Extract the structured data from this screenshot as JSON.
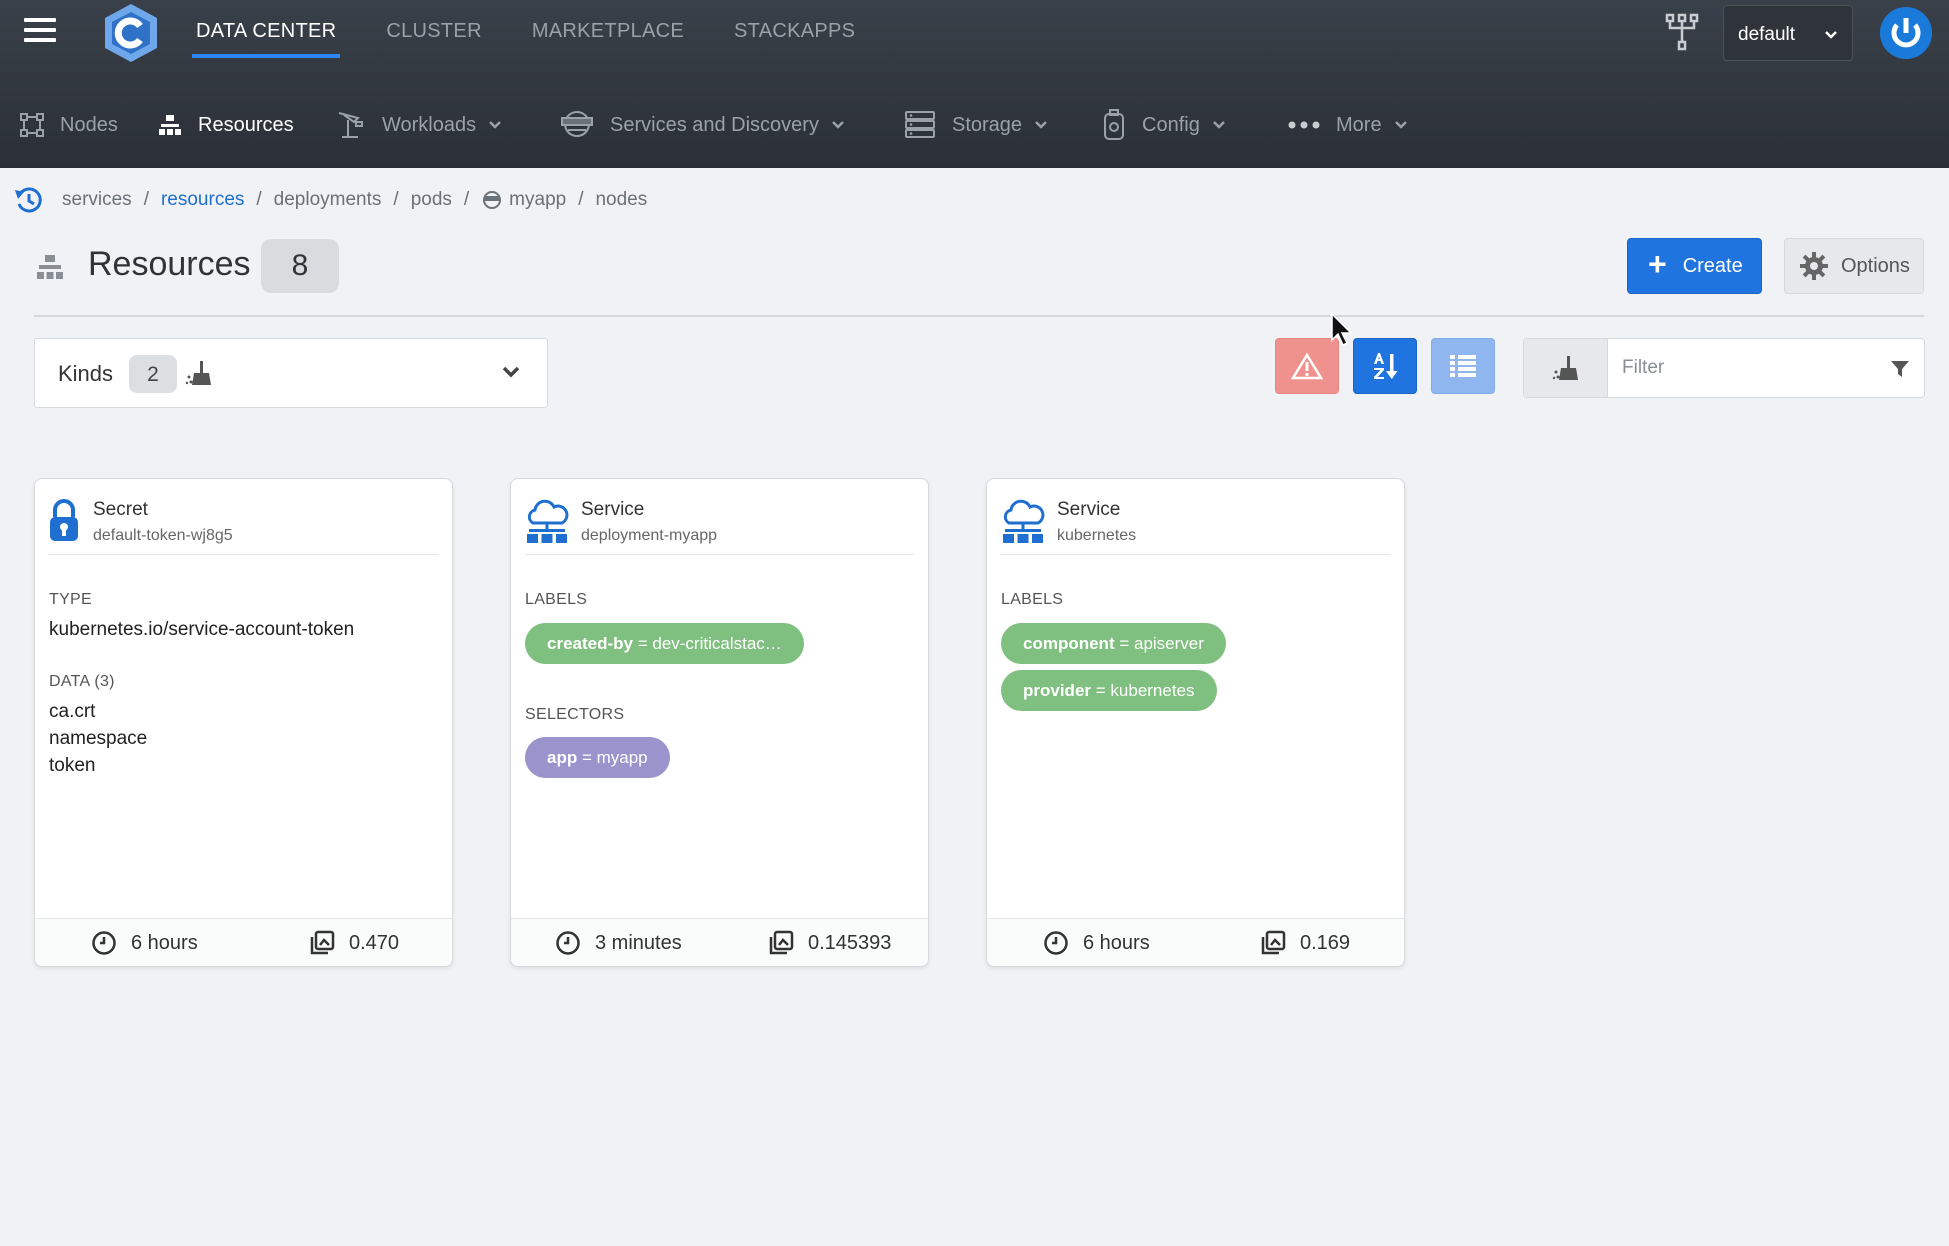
{
  "topnav": {
    "items": [
      "DATA CENTER",
      "CLUSTER",
      "MARKETPLACE",
      "STACKAPPS"
    ],
    "namespace": "default"
  },
  "subnav": {
    "nodes": "Nodes",
    "resources": "Resources",
    "workloads": "Workloads",
    "services": "Services and Discovery",
    "storage": "Storage",
    "config": "Config",
    "more": "More"
  },
  "breadcrumb": {
    "items": [
      "services",
      "resources",
      "deployments",
      "pods",
      "myapp",
      "nodes"
    ],
    "separator": "/"
  },
  "page": {
    "title": "Resources",
    "count": "8",
    "create_label": "Create",
    "options_label": "Options"
  },
  "kinds": {
    "label": "Kinds",
    "count": "2"
  },
  "filter": {
    "placeholder": "Filter"
  },
  "cards": [
    {
      "kind": "Secret",
      "name": "default-token-wj8g5",
      "type_label": "TYPE",
      "type_value": "kubernetes.io/service-account-token",
      "data_label": "DATA (3)",
      "data": [
        "ca.crt",
        "namespace",
        "token"
      ],
      "age": "6 hours",
      "version": "0.470"
    },
    {
      "kind": "Service",
      "name": "deployment-myapp",
      "labels_label": "LABELS",
      "labels": [
        {
          "key": "created-by",
          "value": "dev-criticalstac…"
        }
      ],
      "selectors_label": "SELECTORS",
      "selectors": [
        {
          "key": "app",
          "value": "myapp"
        }
      ],
      "age": "3 minutes",
      "version": "0.145393"
    },
    {
      "kind": "Service",
      "name": "kubernetes",
      "labels_label": "LABELS",
      "labels": [
        {
          "key": "component",
          "value": "apiserver"
        },
        {
          "key": "provider",
          "value": "kubernetes"
        }
      ],
      "age": "6 hours",
      "version": "0.169"
    }
  ],
  "colors": {
    "accent": "#1f74e0",
    "label_pill": "#7fbf7f",
    "selector_pill": "#9a94cc",
    "warning": "#ef928e"
  }
}
